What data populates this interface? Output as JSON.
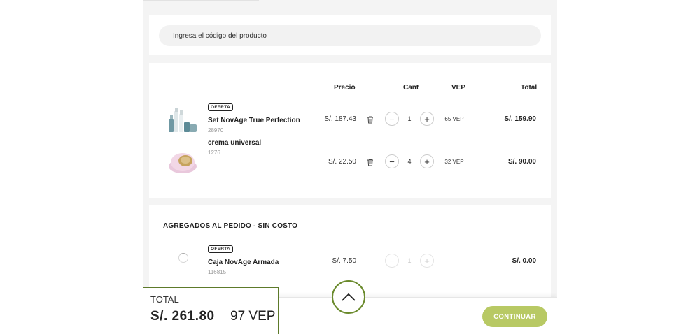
{
  "search": {
    "placeholder": "Ingresa el código del producto"
  },
  "cart": {
    "headers": {
      "price": "Precio",
      "qty": "Cant",
      "vep": "VEP",
      "total": "Total"
    },
    "items": [
      {
        "badge": "OFERTA",
        "name": "Set NovAge True Perfection",
        "code": "28970",
        "price": "S/. 187.43",
        "qty": "1",
        "vep": "65 VEP",
        "total": "S/. 159.90"
      },
      {
        "badge": "",
        "name": "crema universal",
        "code": "1276",
        "price": "S/. 22.50",
        "qty": "4",
        "vep": "32 VEP",
        "total": "S/. 90.00"
      }
    ]
  },
  "extras": {
    "title": "AGREGADOS AL PEDIDO - SIN COSTO",
    "items": [
      {
        "badge": "OFERTA",
        "name": "Caja NovAge Armada",
        "code": "116815",
        "price": "S/. 7.50",
        "qty": "1",
        "total": "S/. 0.00"
      }
    ]
  },
  "summary": {
    "label": "TOTAL",
    "amount": "S/. 261.80",
    "vep": "97 VEP"
  },
  "actions": {
    "continue_label": "CONTINUAR"
  },
  "colors": {
    "accent": "#6a8a2c",
    "button": "#b8c964",
    "background": "#f4f4f4"
  },
  "icons": {
    "delete": "trash-icon",
    "scroll": "chevron-up-icon",
    "loading": "spinner-icon"
  }
}
